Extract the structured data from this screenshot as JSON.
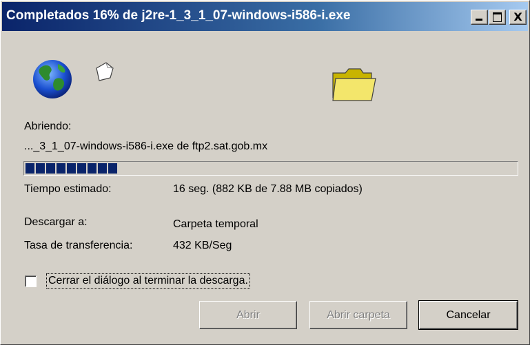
{
  "window": {
    "title": "Completados 16% de j2re-1_3_1_07-windows-i586-i.exe",
    "controls": {
      "minimize": "minimize-icon",
      "maximize": "maximize-icon",
      "close": "X"
    }
  },
  "icons": {
    "globe": "globe-icon",
    "document": "document-icon",
    "folder": "folder-icon"
  },
  "status": {
    "opening_label": "Abriendo:",
    "file_source": "..._3_1_07-windows-i586-i.exe de ftp2.sat.gob.mx"
  },
  "progress": {
    "fraction": 0.16,
    "filled_chunks": 9
  },
  "details": {
    "estimated_label": "Tiempo estimado:",
    "estimated_value": "16 seg. (882 KB de 7.88 MB copiados)",
    "download_to_label": "Descargar a:",
    "download_to_value": "Carpeta temporal",
    "rate_label": "Tasa de transferencia:",
    "rate_value": "432 KB/Seg"
  },
  "checkbox": {
    "label": "Cerrar el diálogo al terminar la descarga.",
    "checked": false
  },
  "buttons": {
    "open": "Abrir",
    "open_folder": "Abrir carpeta",
    "cancel": "Cancelar"
  },
  "colors": {
    "titlebar_start": "#0a246a",
    "titlebar_end": "#a6caf0",
    "dialog_bg": "#d4d0c8",
    "progress_fill": "#0a246a"
  }
}
